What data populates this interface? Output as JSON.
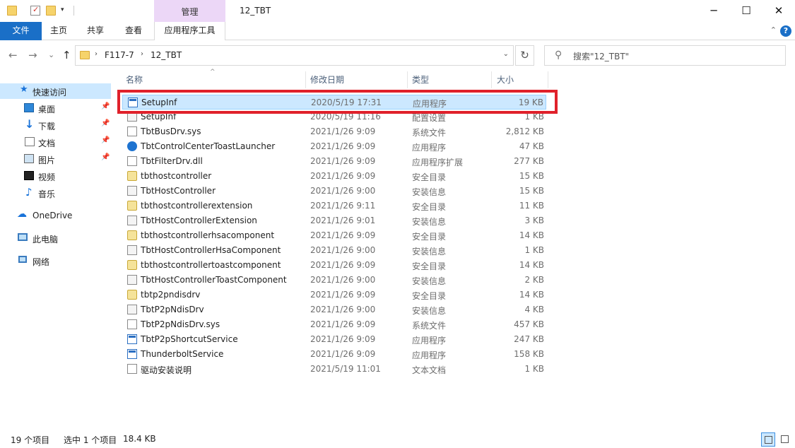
{
  "window": {
    "title": "12_TBT",
    "context_tab": "管理",
    "minimize": "─",
    "maximize": "☐",
    "close": "✕"
  },
  "ribbon": {
    "tabs": [
      "文件",
      "主页",
      "共享",
      "查看",
      "应用程序工具"
    ],
    "collapse": "⌃",
    "help": "?"
  },
  "navigation": {
    "back": "←",
    "forward": "→",
    "recent": "⌄",
    "up": "↑",
    "breadcrumb": [
      "F117-7",
      "12_TBT"
    ],
    "refresh": "↻",
    "search_placeholder": "搜索\"12_TBT\""
  },
  "nav_pane": {
    "quick_access": "快速访问",
    "items": [
      {
        "label": "桌面",
        "icon": "desktop-icon",
        "pinned": true
      },
      {
        "label": "下载",
        "icon": "download-icon",
        "pinned": true
      },
      {
        "label": "文档",
        "icon": "documents-icon",
        "pinned": true
      },
      {
        "label": "图片",
        "icon": "pictures-icon",
        "pinned": true
      },
      {
        "label": "视频",
        "icon": "videos-icon",
        "pinned": false
      },
      {
        "label": "音乐",
        "icon": "music-icon",
        "pinned": false
      }
    ],
    "onedrive": "OneDrive",
    "this_pc": "此电脑",
    "network": "网络"
  },
  "columns": {
    "name": "名称",
    "date": "修改日期",
    "type": "类型",
    "size": "大小"
  },
  "files": [
    {
      "name": "SetupInf",
      "date": "2020/5/19 17:31",
      "type": "应用程序",
      "size": "19 KB",
      "icon": "app",
      "selected": true
    },
    {
      "name": "SetupInf",
      "date": "2020/5/19 11:16",
      "type": "配置设置",
      "size": "1 KB",
      "icon": "inf",
      "selected": false
    },
    {
      "name": "TbtBusDrv.sys",
      "date": "2021/1/26 9:09",
      "type": "系统文件",
      "size": "2,812 KB",
      "icon": "sys",
      "selected": false
    },
    {
      "name": "TbtControlCenterToastLauncher",
      "date": "2021/1/26 9:09",
      "type": "应用程序",
      "size": "47 KB",
      "icon": "tb",
      "selected": false
    },
    {
      "name": "TbtFilterDrv.dll",
      "date": "2021/1/26 9:09",
      "type": "应用程序扩展",
      "size": "277 KB",
      "icon": "sys",
      "selected": false
    },
    {
      "name": "tbthostcontroller",
      "date": "2021/1/26 9:09",
      "type": "安全目录",
      "size": "15 KB",
      "icon": "cat",
      "selected": false
    },
    {
      "name": "TbtHostController",
      "date": "2021/1/26 9:00",
      "type": "安装信息",
      "size": "15 KB",
      "icon": "inf",
      "selected": false
    },
    {
      "name": "tbthostcontrollerextension",
      "date": "2021/1/26 9:11",
      "type": "安全目录",
      "size": "11 KB",
      "icon": "cat",
      "selected": false
    },
    {
      "name": "TbtHostControllerExtension",
      "date": "2021/1/26 9:01",
      "type": "安装信息",
      "size": "3 KB",
      "icon": "inf",
      "selected": false
    },
    {
      "name": "tbthostcontrollerhsacomponent",
      "date": "2021/1/26 9:09",
      "type": "安全目录",
      "size": "14 KB",
      "icon": "cat",
      "selected": false
    },
    {
      "name": "TbtHostControllerHsaComponent",
      "date": "2021/1/26 9:00",
      "type": "安装信息",
      "size": "1 KB",
      "icon": "inf",
      "selected": false
    },
    {
      "name": "tbthostcontrollertoastcomponent",
      "date": "2021/1/26 9:09",
      "type": "安全目录",
      "size": "14 KB",
      "icon": "cat",
      "selected": false
    },
    {
      "name": "TbtHostControllerToastComponent",
      "date": "2021/1/26 9:00",
      "type": "安装信息",
      "size": "2 KB",
      "icon": "inf",
      "selected": false
    },
    {
      "name": "tbtp2pndisdrv",
      "date": "2021/1/26 9:09",
      "type": "安全目录",
      "size": "14 KB",
      "icon": "cat",
      "selected": false
    },
    {
      "name": "TbtP2pNdisDrv",
      "date": "2021/1/26 9:00",
      "type": "安装信息",
      "size": "4 KB",
      "icon": "inf",
      "selected": false
    },
    {
      "name": "TbtP2pNdisDrv.sys",
      "date": "2021/1/26 9:09",
      "type": "系统文件",
      "size": "457 KB",
      "icon": "sys",
      "selected": false
    },
    {
      "name": "TbtP2pShortcutService",
      "date": "2021/1/26 9:09",
      "type": "应用程序",
      "size": "247 KB",
      "icon": "app",
      "selected": false
    },
    {
      "name": "ThunderboltService",
      "date": "2021/1/26 9:09",
      "type": "应用程序",
      "size": "158 KB",
      "icon": "app",
      "selected": false
    },
    {
      "name": "驱动安装说明",
      "date": "2021/5/19 11:01",
      "type": "文本文档",
      "size": "1 KB",
      "icon": "txt",
      "selected": false
    }
  ],
  "status": {
    "item_count": "19 个项目",
    "selected": "选中 1 个项目",
    "selected_size": "18.4 KB"
  },
  "colors": {
    "accent": "#1a6fc7",
    "selection": "#cce8ff",
    "highlight_box": "#e0212b",
    "manage_tab": "#ecd7f7"
  }
}
